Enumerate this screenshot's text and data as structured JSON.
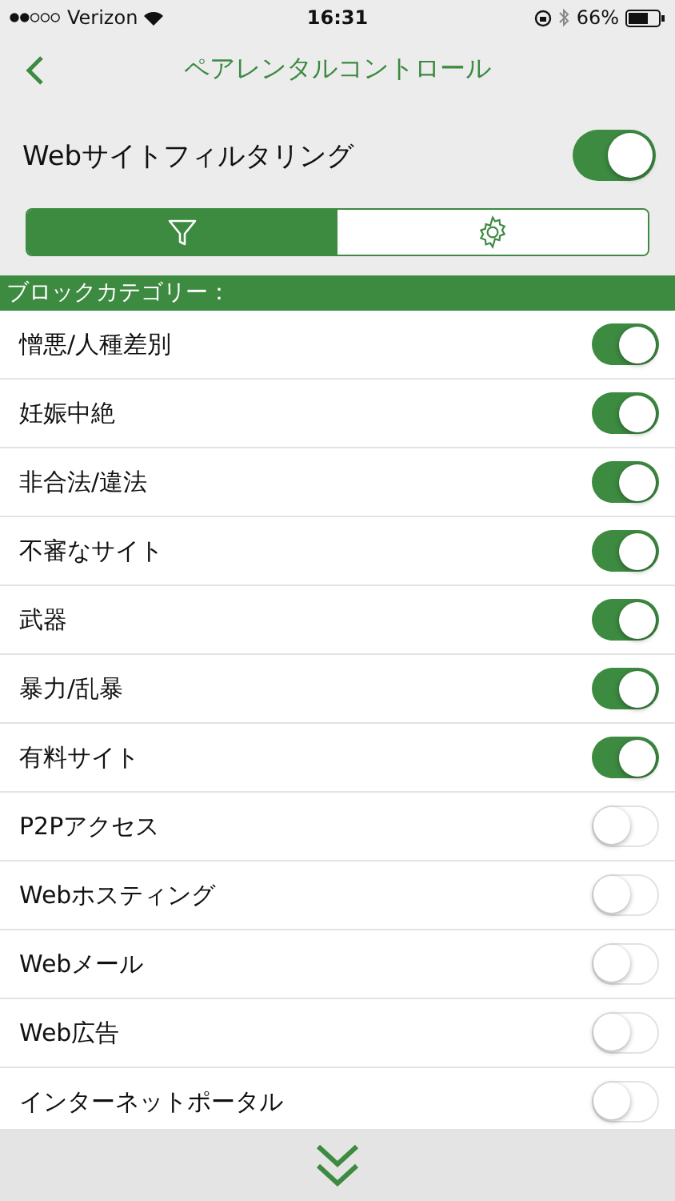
{
  "status_bar": {
    "carrier": "Verizon",
    "time": "16:31",
    "battery_percent": "66%"
  },
  "nav": {
    "title": "ペアレンタルコントロール"
  },
  "filtering": {
    "label": "Webサイトフィルタリング",
    "on": true
  },
  "segments": [
    {
      "kind": "filter",
      "selected": true
    },
    {
      "kind": "settings",
      "selected": false
    }
  ],
  "section_header": "ブロックカテゴリー：",
  "categories": [
    {
      "label": "憎悪/人種差別",
      "on": true
    },
    {
      "label": "妊娠中絶",
      "on": true
    },
    {
      "label": "非合法/違法",
      "on": true
    },
    {
      "label": "不審なサイト",
      "on": true
    },
    {
      "label": "武器",
      "on": true
    },
    {
      "label": "暴力/乱暴",
      "on": true
    },
    {
      "label": "有料サイト",
      "on": true
    },
    {
      "label": "P2Pアクセス",
      "on": false
    },
    {
      "label": "Webホスティング",
      "on": false
    },
    {
      "label": "Webメール",
      "on": false
    },
    {
      "label": "Web広告",
      "on": false
    },
    {
      "label": "インターネットポータル",
      "on": false
    }
  ]
}
